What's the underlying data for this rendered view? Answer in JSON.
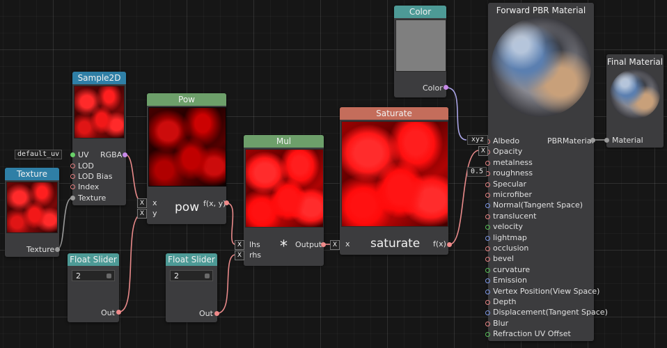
{
  "nodes": {
    "sample2d": {
      "title": "Sample2D",
      "in_uv_value": "default_uv",
      "in_uv": "UV",
      "in_lod": "LOD",
      "in_lod_bias": "LOD Bias",
      "in_index": "Index",
      "in_texture": "Texture",
      "out_rgba": "RGBA"
    },
    "texture": {
      "title": "Texture",
      "out": "Texture"
    },
    "pow": {
      "title": "Pow",
      "label": "pow",
      "in_x": "x",
      "in_y": "y",
      "out": "f(x, y)",
      "x_mark": "X"
    },
    "mul": {
      "title": "Mul",
      "label": "*",
      "in_lhs": "lhs",
      "in_rhs": "rhs",
      "out": "Output",
      "x_mark": "X"
    },
    "saturate": {
      "title": "Saturate",
      "label": "saturate",
      "in_x": "x",
      "out": "f(x)",
      "x_mark": "X"
    },
    "float_slider_1": {
      "title": "Float Slider",
      "value": "2",
      "out": "Out"
    },
    "float_slider_2": {
      "title": "Float Slider",
      "value": "2",
      "out": "Out"
    },
    "color": {
      "title": "Color",
      "out": "Color"
    },
    "pbr": {
      "title": "Forward PBR Material",
      "out": "PBRMaterial",
      "albedo_value": "xyz",
      "roughness_value": "0.5",
      "opacity_mark": "X",
      "inputs": [
        "Albedo",
        "Opacity",
        "metalness",
        "roughness",
        "Specular",
        "microfiber",
        "Normal(Tangent Space)",
        "translucent",
        "velocity",
        "lightmap",
        "occlusion",
        "bevel",
        "curvature",
        "Emission",
        "Vertex Position(View Space)",
        "Depth",
        "Displacement(Tangent Space)",
        "Blur",
        "Refraction UV Offset"
      ]
    },
    "final": {
      "title": "Final Material",
      "in": "Material"
    }
  },
  "colors": {
    "wire_pink": "#e98a8a",
    "wire_grey": "#9a9a9a",
    "wire_purple": "#b79ae6",
    "wire_lavender": "#a9a4e6"
  }
}
